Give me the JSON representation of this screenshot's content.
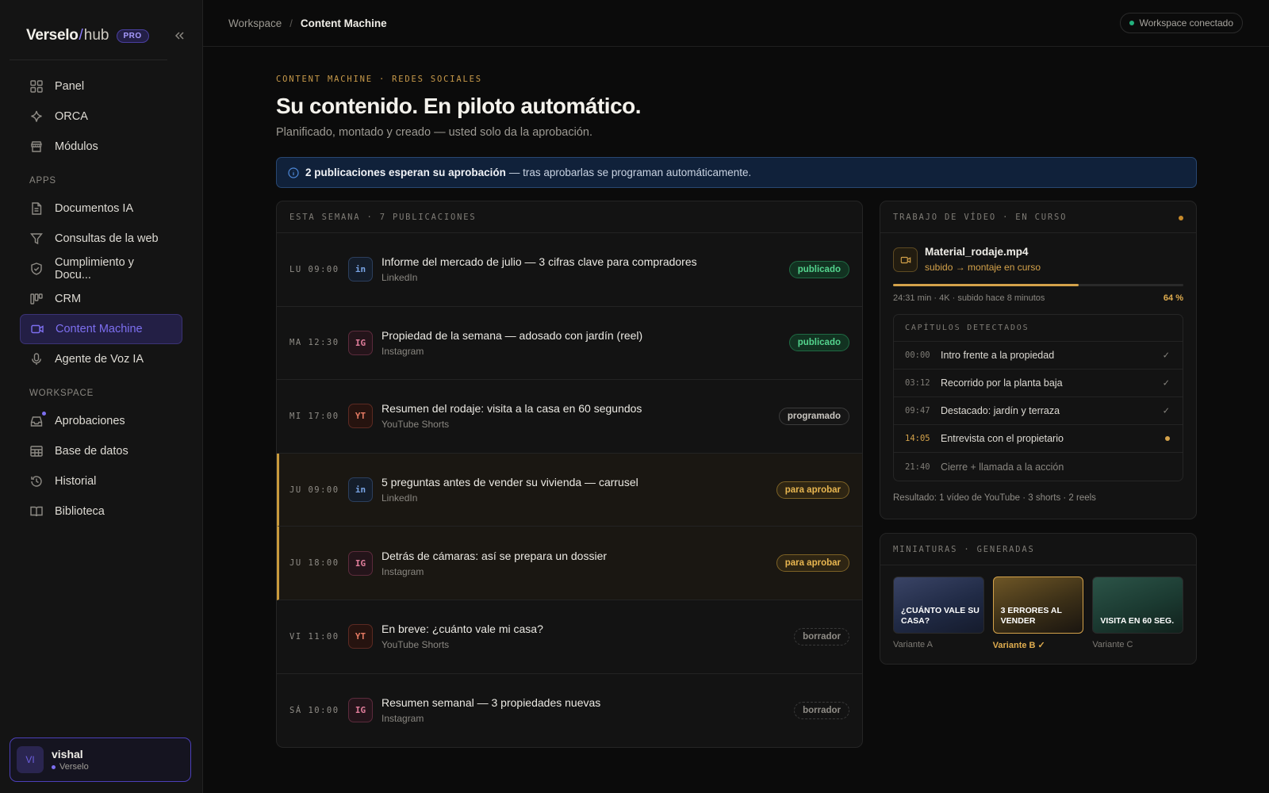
{
  "brand": {
    "name": "Verselo",
    "slash": "/",
    "suffix": "hub",
    "badge": "PRO"
  },
  "nav": {
    "primary": [
      {
        "label": "Panel"
      },
      {
        "label": "ORCA"
      },
      {
        "label": "Módulos"
      }
    ],
    "apps_title": "APPS",
    "apps": [
      {
        "label": "Documentos IA"
      },
      {
        "label": "Consultas de la web"
      },
      {
        "label": "Cumplimiento y Docu..."
      },
      {
        "label": "CRM"
      },
      {
        "label": "Content Machine"
      },
      {
        "label": "Agente de Voz IA"
      }
    ],
    "workspace_title": "WORKSPACE",
    "workspace": [
      {
        "label": "Aprobaciones"
      },
      {
        "label": "Base de datos"
      },
      {
        "label": "Historial"
      },
      {
        "label": "Biblioteca"
      }
    ]
  },
  "user": {
    "initials": "VI",
    "name": "vishal",
    "org": "Verselo"
  },
  "breadcrumb": {
    "root": "Workspace",
    "sep": "/",
    "current": "Content Machine"
  },
  "status": {
    "label": "Workspace conectado"
  },
  "header": {
    "eyebrow": "CONTENT MACHINE · REDES SOCIALES",
    "title": "Su contenido. En piloto automático.",
    "subtitle": "Planificado, montado y creado — usted solo da la aprobación."
  },
  "alert": {
    "bold": "2 publicaciones esperan su aprobación",
    "text": "— tras aprobarlas se programan automáticamente."
  },
  "week": {
    "title": "ESTA SEMANA · 7 PUBLICACIONES",
    "posts": [
      {
        "time": "LU 09:00",
        "net": "in",
        "title": "Informe del mercado de julio — 3 cifras clave para compradores",
        "channel": "LinkedIn",
        "status": "publicado"
      },
      {
        "time": "MA 12:30",
        "net": "IG",
        "title": "Propiedad de la semana — adosado con jardín (reel)",
        "channel": "Instagram",
        "status": "publicado"
      },
      {
        "time": "MI 17:00",
        "net": "YT",
        "title": "Resumen del rodaje: visita a la casa en 60 segundos",
        "channel": "YouTube Shorts",
        "status": "programado"
      },
      {
        "time": "JU 09:00",
        "net": "in",
        "title": "5 preguntas antes de vender su vivienda — carrusel",
        "channel": "LinkedIn",
        "status": "para aprobar"
      },
      {
        "time": "JU 18:00",
        "net": "IG",
        "title": "Detrás de cámaras: así se prepara un dossier",
        "channel": "Instagram",
        "status": "para aprobar"
      },
      {
        "time": "VI 11:00",
        "net": "YT",
        "title": "En breve: ¿cuánto vale mi casa?",
        "channel": "YouTube Shorts",
        "status": "borrador"
      },
      {
        "time": "SÁ 10:00",
        "net": "IG",
        "title": "Resumen semanal — 3 propiedades nuevas",
        "channel": "Instagram",
        "status": "borrador"
      }
    ]
  },
  "video": {
    "title": "TRABAJO DE VÍDEO · EN CURSO",
    "file": "Material_rodaje.mp4",
    "state": "subido → montaje en curso",
    "progress": 0.64,
    "meta": "24:31 min · 4K · subido hace 8 minutos",
    "percent": "64 %",
    "chapters_title": "CAPÍTULOS DETECTADOS",
    "chapters": [
      {
        "time": "00:00",
        "label": "Intro frente a la propiedad",
        "state": "done"
      },
      {
        "time": "03:12",
        "label": "Recorrido por la planta baja",
        "state": "done"
      },
      {
        "time": "09:47",
        "label": "Destacado: jardín y terraza",
        "state": "done"
      },
      {
        "time": "14:05",
        "label": "Entrevista con el propietario",
        "state": "doing"
      },
      {
        "time": "21:40",
        "label": "Cierre + llamada a la acción",
        "state": "todo"
      }
    ],
    "result": "Resultado: 1 vídeo de YouTube · 3 shorts · 2 reels"
  },
  "thumbs": {
    "title": "MINIATURAS · GENERADAS",
    "items": [
      {
        "text": "¿CUÁNTO VALE SU CASA?",
        "label": "Variante A"
      },
      {
        "text": "3 ERRORES AL VENDER",
        "label": "Variante B ✓"
      },
      {
        "text": "VISITA EN 60 SEG.",
        "label": "Variante C"
      }
    ]
  },
  "colors": {
    "accent": "#7d6ff0",
    "amber": "#d4a24a",
    "success": "#54d48e",
    "info": "#4d88d8"
  }
}
